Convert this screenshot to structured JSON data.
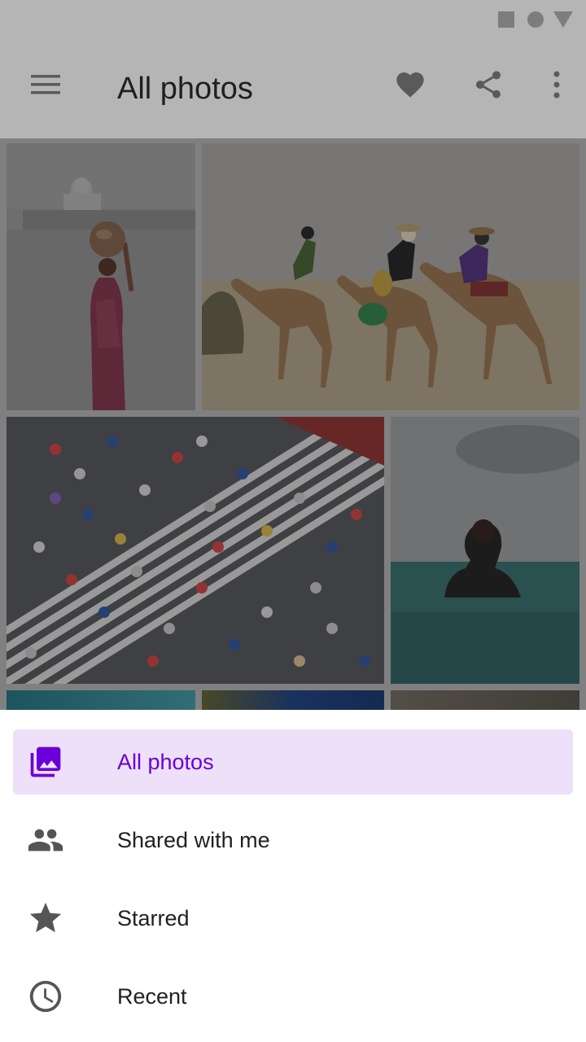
{
  "status_bar": {
    "icons": [
      "square-icon",
      "circle-icon",
      "triangle-icon"
    ]
  },
  "app_bar": {
    "title": "All photos",
    "icons": [
      "menu-icon",
      "heart-icon",
      "share-icon",
      "more-vert-icon"
    ]
  },
  "photos": [
    {
      "subject": "woman-carrying-pot-taj-mahal"
    },
    {
      "subject": "camel-riders-desert"
    },
    {
      "subject": "crosswalk-umbrellas"
    },
    {
      "subject": "woman-hot-spring"
    },
    {
      "subject": "blue-sky"
    },
    {
      "subject": "escalator"
    },
    {
      "subject": "landscape"
    }
  ],
  "drawer": {
    "selected_index": 0,
    "items": [
      {
        "label": "All photos",
        "icon": "photo-library-icon"
      },
      {
        "label": "Shared with me",
        "icon": "people-icon"
      },
      {
        "label": "Starred",
        "icon": "star-icon"
      },
      {
        "label": "Recent",
        "icon": "clock-icon"
      }
    ]
  },
  "colors": {
    "accent": "#6a00d9",
    "selected_bg": "#ede0f8",
    "scrim": "#b5b5b5",
    "icon_gray": "#555555"
  }
}
